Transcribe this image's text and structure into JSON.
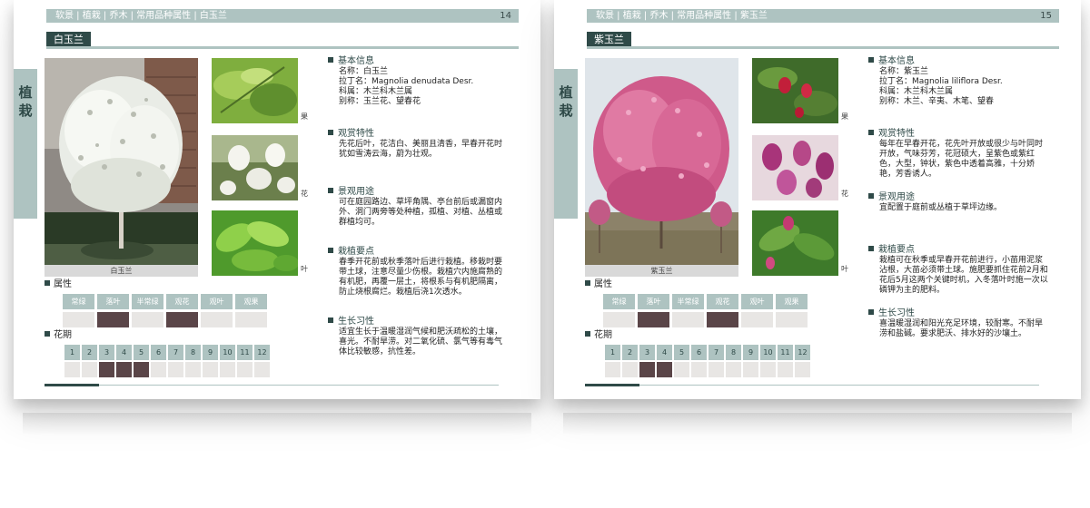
{
  "pages": [
    {
      "breadcrumb": "软景 | 植栽 | 乔木 | 常用品种属性 | 白玉兰",
      "page_number": "14",
      "title": "白玉兰",
      "side_tab": "植栽",
      "main_caption": "白玉兰",
      "thumb_labels": [
        "果",
        "花",
        "叶"
      ],
      "attributes": {
        "label": "属性",
        "headers": [
          "常绿",
          "落叶",
          "半常绿",
          "观花",
          "观叶",
          "观果"
        ],
        "active": [
          false,
          true,
          false,
          true,
          false,
          false
        ]
      },
      "bloom": {
        "label": "花期",
        "months": [
          "1",
          "2",
          "3",
          "4",
          "5",
          "6",
          "7",
          "8",
          "9",
          "10",
          "11",
          "12"
        ],
        "active": [
          false,
          false,
          true,
          true,
          true,
          false,
          false,
          false,
          false,
          false,
          false,
          false
        ]
      },
      "info": {
        "basic_title": "基本信息",
        "name": "名称：白玉兰",
        "latin": "拉丁名：Magnolia denudata Desr.",
        "family": "科属：木兰科木兰属",
        "alias": "别称：玉兰花、望春花",
        "ornamental_title": "观赏特性",
        "ornamental_text": "先花后叶，花洁白、美丽且清香，早春开花时犹如雪涛云海，蔚为壮观。",
        "landscape_title": "景观用途",
        "landscape_text": "可在庭园路边、草坪角隅、亭台前后或漏窗内外、洞门两旁等处种植，孤植、对植、丛植或群植均可。",
        "planting_title": "栽植要点",
        "planting_text": "春季开花前或秋季落叶后进行栽植。移栽时要带土球，注意尽量少伤根。栽植穴内施腐熟的有机肥，再覆一层土，将根系与有机肥隔离，防止烧根腐烂。栽植后浇1次透水。",
        "habit_title": "生长习性",
        "habit_text": "适宜生长于温暖湿润气候和肥沃疏松的土壤，喜光。不耐旱涝。对二氧化硫、氯气等有毒气体比较敏感，抗性差。"
      }
    },
    {
      "breadcrumb": "软景 | 植栽 | 乔木 | 常用品种属性 | 紫玉兰",
      "page_number": "15",
      "title": "紫玉兰",
      "side_tab": "植栽",
      "main_caption": "紫玉兰",
      "thumb_labels": [
        "果",
        "花",
        "叶"
      ],
      "attributes": {
        "label": "属性",
        "headers": [
          "常绿",
          "落叶",
          "半常绿",
          "观花",
          "观叶",
          "观果"
        ],
        "active": [
          false,
          true,
          false,
          true,
          false,
          false
        ]
      },
      "bloom": {
        "label": "花期",
        "months": [
          "1",
          "2",
          "3",
          "4",
          "5",
          "6",
          "7",
          "8",
          "9",
          "10",
          "11",
          "12"
        ],
        "active": [
          false,
          false,
          true,
          true,
          false,
          false,
          false,
          false,
          false,
          false,
          false,
          false
        ]
      },
      "info": {
        "basic_title": "基本信息",
        "name": "名称：紫玉兰",
        "latin": "拉丁名：Magnolia liliflora Desr.",
        "family": "科属：木兰科木兰属",
        "alias": "别称：木兰、辛夷、木笔、望春",
        "ornamental_title": "观赏特性",
        "ornamental_text": "每年在早春开花，花先叶开放或很少与叶同时开放，气味芬芳，花冠硕大，呈紫色或紫红色，大型，钟状，紫色中透着高雅，十分娇艳，芳香诱人。",
        "landscape_title": "景观用途",
        "landscape_text": "宜配置于庭前或丛植于草坪边缘。",
        "planting_title": "栽植要点",
        "planting_text": "栽植可在秋季或早春开花前进行，小苗用泥浆沾根，大苗必须带土球。施肥要抓住花前2月和花后5月这两个关键时机，入冬落叶时施一次以磷钾为主的肥料。",
        "habit_title": "生长习性",
        "habit_text": "喜温暖湿润和阳光充足环境，较耐寒。不耐旱涝和盐碱。要求肥沃、排水好的沙壤土。"
      }
    }
  ]
}
